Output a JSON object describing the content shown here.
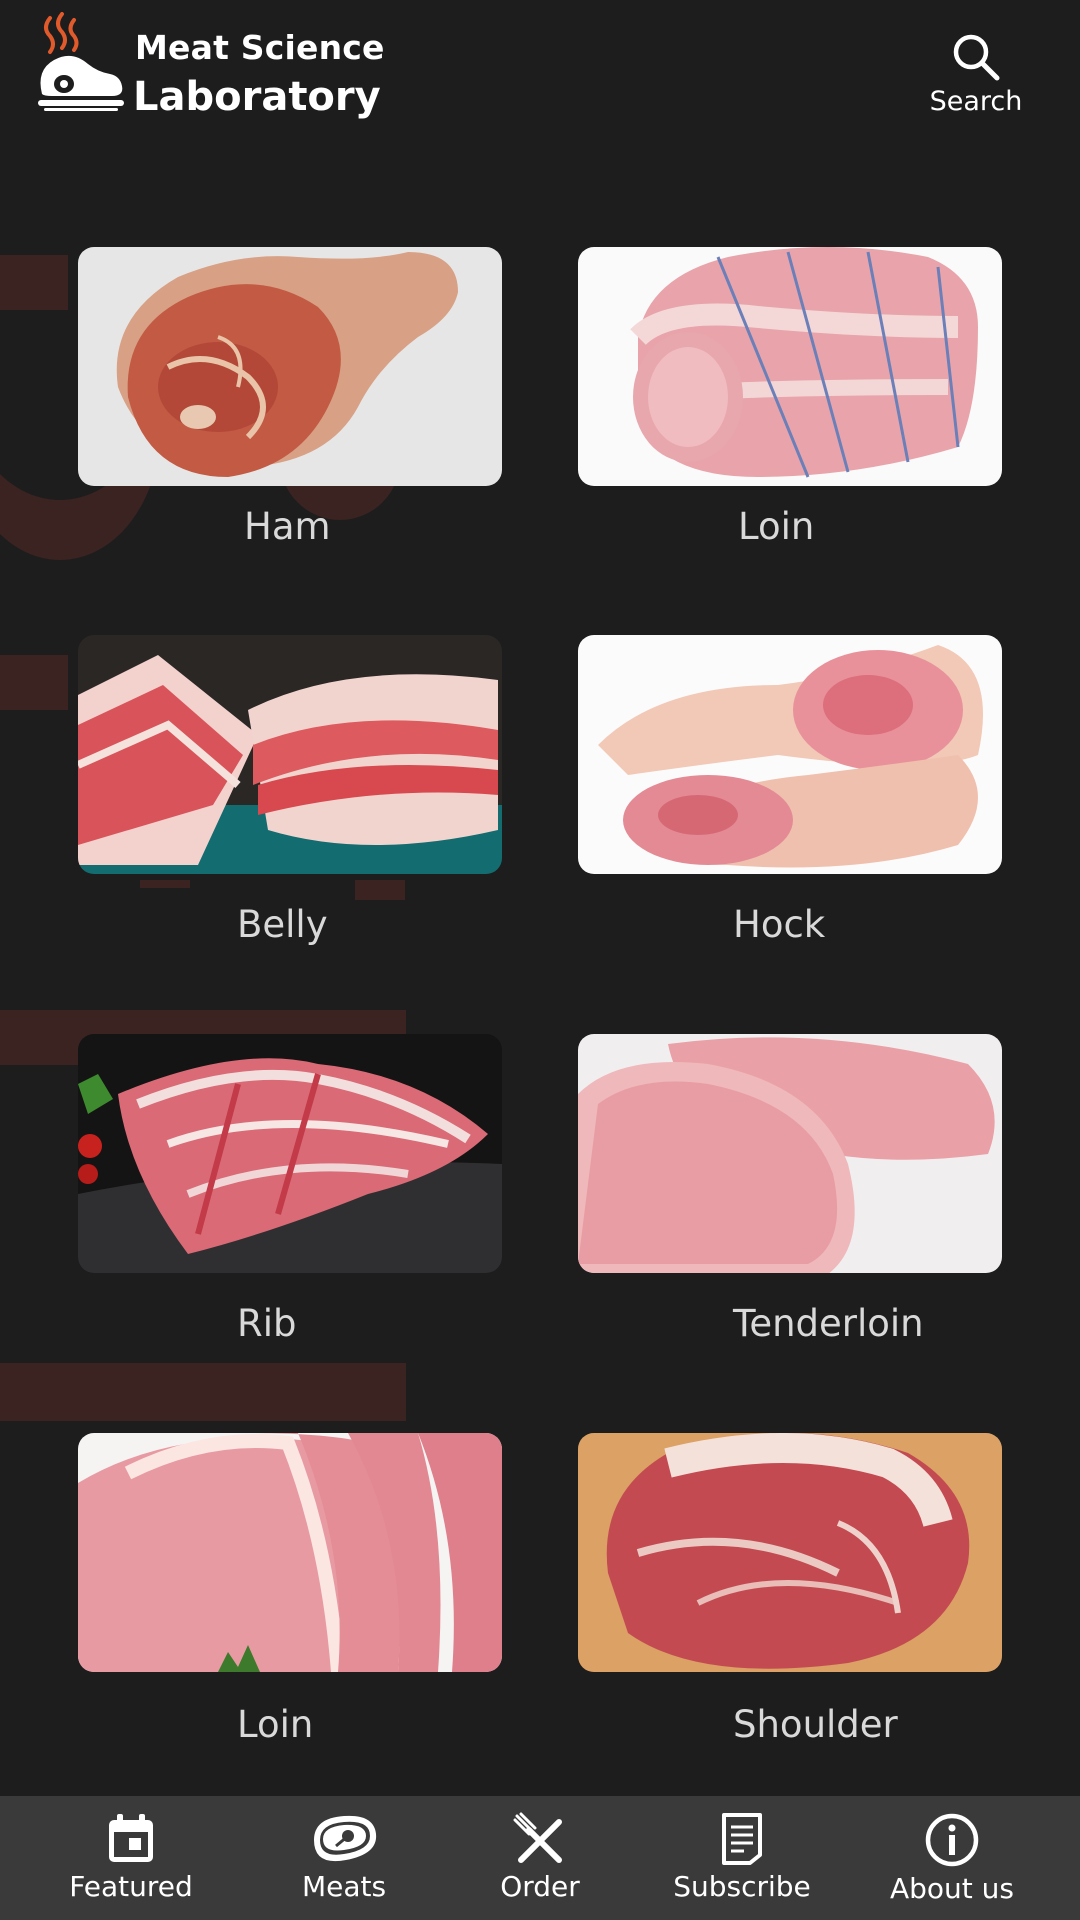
{
  "app": {
    "brand_line1": "Meat Science",
    "brand_line2": "Laboratory"
  },
  "header": {
    "search_label": "Search",
    "search_icon": "search-icon",
    "logo_icon": "smoking-ham-logo"
  },
  "grid": {
    "items": [
      {
        "label": "Ham",
        "image": "ham-photo"
      },
      {
        "label": "Loin",
        "image": "tied-loin-roast-photo"
      },
      {
        "label": "Belly",
        "image": "pork-belly-photo"
      },
      {
        "label": "Hock",
        "image": "pork-hock-photo"
      },
      {
        "label": "Rib",
        "image": "spare-ribs-photo"
      },
      {
        "label": "Tenderloin",
        "image": "tenderloin-chops-photo"
      },
      {
        "label": "Loin",
        "image": "loin-chops-photo"
      },
      {
        "label": "Shoulder",
        "image": "pork-shoulder-photo"
      }
    ]
  },
  "bottom_nav": {
    "items": [
      {
        "label": "Featured",
        "icon": "calendar-icon"
      },
      {
        "label": "Meats",
        "icon": "steak-icon"
      },
      {
        "label": "Order",
        "icon": "fork-knife-icon"
      },
      {
        "label": "Subscribe",
        "icon": "document-icon"
      },
      {
        "label": "About us",
        "icon": "info-icon"
      }
    ]
  },
  "colors": {
    "background": "#1d1d1e",
    "nav_background": "#3a3a3b",
    "watermark": "#3a2320",
    "logo_flame": "#e05a2b",
    "label_text": "#d9d9d9"
  }
}
